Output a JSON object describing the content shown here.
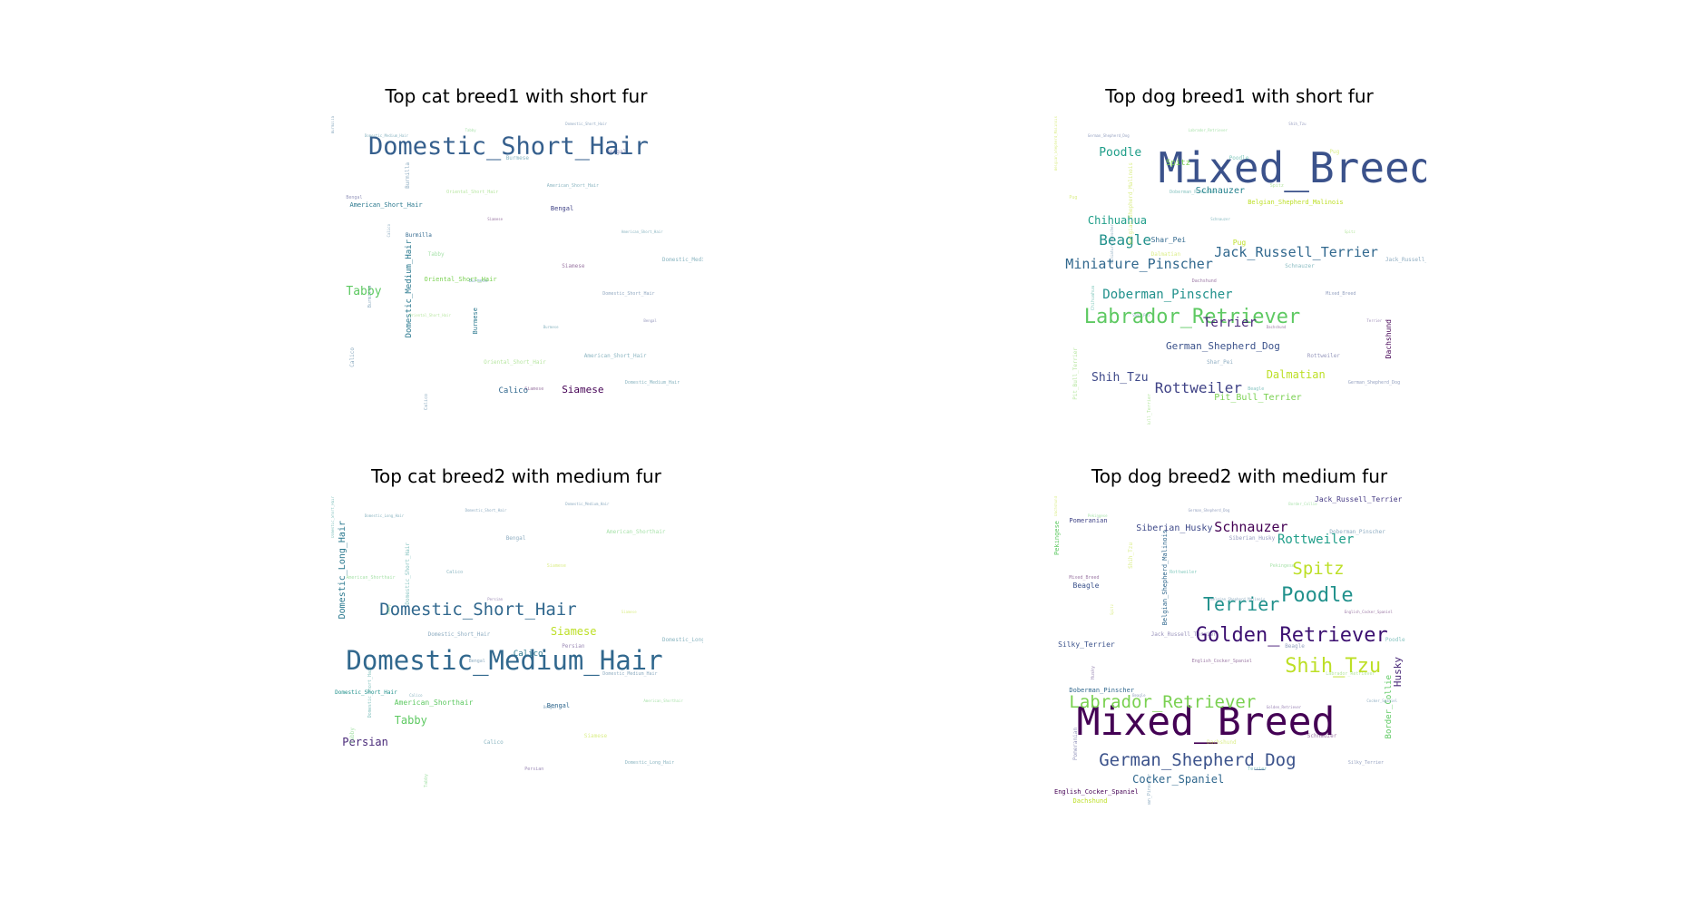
{
  "chart_data": [
    {
      "type": "wordcloud",
      "title": "Top cat breed1 with short fur",
      "words": [
        {
          "text": "Domestic_Short_Hair",
          "weight": 100,
          "color": "#355f8d"
        },
        {
          "text": "Tabby",
          "weight": 30,
          "color": "#5ec962"
        },
        {
          "text": "Domestic_Medium_Hair",
          "weight": 17,
          "color": "#2a788e",
          "vertical": true
        },
        {
          "text": "Siamese",
          "weight": 23,
          "color": "#440154"
        },
        {
          "text": "Calico",
          "weight": 18,
          "color": "#31688e"
        },
        {
          "text": "American_Short_Hair",
          "weight": 13,
          "color": "#2a788e"
        },
        {
          "text": "Oriental_Short_Hair",
          "weight": 12,
          "color": "#7ad151"
        },
        {
          "text": "Bengal",
          "weight": 12,
          "color": "#414487"
        },
        {
          "text": "Burmese",
          "weight": 10,
          "color": "#2a788e",
          "vertical": true
        },
        {
          "text": "Burmilla",
          "weight": 10,
          "color": "#31688e"
        }
      ]
    },
    {
      "type": "wordcloud",
      "title": "Top dog breed1 with short fur",
      "words": [
        {
          "text": "Mixed_Breed",
          "weight": 100,
          "color": "#3b528b"
        },
        {
          "text": "Labrador_Retriever",
          "weight": 52,
          "color": "#5ec962"
        },
        {
          "text": "Jack_Russell_Terrier",
          "weight": 36,
          "color": "#31688e"
        },
        {
          "text": "Beagle",
          "weight": 38,
          "color": "#21918c"
        },
        {
          "text": "Miniature_Pinscher",
          "weight": 35,
          "color": "#31688e"
        },
        {
          "text": "Rottweiler",
          "weight": 37,
          "color": "#414487"
        },
        {
          "text": "Doberman_Pinscher",
          "weight": 31,
          "color": "#21918c"
        },
        {
          "text": "Terrier",
          "weight": 31,
          "color": "#482878"
        },
        {
          "text": "Poodle",
          "weight": 30,
          "color": "#1f9e89"
        },
        {
          "text": "Chihuahua",
          "weight": 28,
          "color": "#1f9e89"
        },
        {
          "text": "Shih_Tzu",
          "weight": 30,
          "color": "#3e4989"
        },
        {
          "text": "Dalmatian",
          "weight": 28,
          "color": "#bddf26"
        },
        {
          "text": "German_Shepherd_Dog",
          "weight": 25,
          "color": "#3b528b"
        },
        {
          "text": "Schnauzer",
          "weight": 22,
          "color": "#26828e"
        },
        {
          "text": "Pit_Bull_Terrier",
          "weight": 21,
          "color": "#7ad151"
        },
        {
          "text": "Spitz",
          "weight": 20,
          "color": "#7ad151"
        },
        {
          "text": "Shar_Pei",
          "weight": 17,
          "color": "#31688e"
        },
        {
          "text": "Pug",
          "weight": 17,
          "color": "#bddf26"
        },
        {
          "text": "Dachshund",
          "weight": 17,
          "color": "#440154",
          "vertical": true
        },
        {
          "text": "Belgian_Shepherd_Malinois",
          "weight": 15,
          "color": "#bddf26"
        }
      ]
    },
    {
      "type": "wordcloud",
      "title": "Top cat breed2 with medium fur",
      "words": [
        {
          "text": "Domestic_Medium_Hair",
          "weight": 100,
          "color": "#31688e"
        },
        {
          "text": "Domestic_Short_Hair",
          "weight": 65,
          "color": "#31688e"
        },
        {
          "text": "Domestic_Long_Hair",
          "weight": 35,
          "color": "#2a788e",
          "vertical": true
        },
        {
          "text": "Persian",
          "weight": 34,
          "color": "#482878"
        },
        {
          "text": "Tabby",
          "weight": 34,
          "color": "#5ec962"
        },
        {
          "text": "Siamese",
          "weight": 30,
          "color": "#bddf26"
        },
        {
          "text": "Calico",
          "weight": 24,
          "color": "#2a788e"
        },
        {
          "text": "American_Shorthair",
          "weight": 18,
          "color": "#5ec962"
        },
        {
          "text": "Bengal",
          "weight": 16,
          "color": "#31688e"
        },
        {
          "text": "Domestic_Short_Hair",
          "weight": 14,
          "color": "#21918c"
        }
      ]
    },
    {
      "type": "wordcloud",
      "title": "Top dog breed2 with medium fur",
      "words": [
        {
          "text": "Mixed_Breed",
          "weight": 100,
          "color": "#440154"
        },
        {
          "text": "Golden_Retriever",
          "weight": 53,
          "color": "#3b0f70"
        },
        {
          "text": "Shih_Tzu",
          "weight": 55,
          "color": "#bddf26"
        },
        {
          "text": "Labrador_Retriever",
          "weight": 44,
          "color": "#7ad151"
        },
        {
          "text": "German_Shepherd_Dog",
          "weight": 44,
          "color": "#3b528b"
        },
        {
          "text": "Poodle",
          "weight": 50,
          "color": "#21918c"
        },
        {
          "text": "Terrier",
          "weight": 48,
          "color": "#21918c"
        },
        {
          "text": "Spitz",
          "weight": 44,
          "color": "#bddf26"
        },
        {
          "text": "Schnauzer",
          "weight": 36,
          "color": "#440154"
        },
        {
          "text": "Rottweiler",
          "weight": 30,
          "color": "#1f9e89"
        },
        {
          "text": "Cocker_Spaniel",
          "weight": 27,
          "color": "#31688e"
        },
        {
          "text": "Siberian_Husky",
          "weight": 23,
          "color": "#3e4989"
        },
        {
          "text": "Husky",
          "weight": 23,
          "color": "#482878",
          "vertical": true
        },
        {
          "text": "Border_Collie",
          "weight": 20,
          "color": "#5ec962",
          "vertical": true
        },
        {
          "text": "Jack_Russell_Terrier",
          "weight": 20,
          "color": "#443983"
        },
        {
          "text": "Silky_Terrier",
          "weight": 19,
          "color": "#3b528b"
        },
        {
          "text": "Belgian_Shepherd_Malinois",
          "weight": 18,
          "color": "#31688e",
          "vertical": true
        },
        {
          "text": "Pomeranian",
          "weight": 18,
          "color": "#414487"
        },
        {
          "text": "Pekingese",
          "weight": 18,
          "color": "#5ec962",
          "vertical": true
        },
        {
          "text": "Beagle",
          "weight": 17,
          "color": "#3b528b"
        },
        {
          "text": "Doberman_Pinscher",
          "weight": 16,
          "color": "#31688e"
        },
        {
          "text": "English_Cocker_Spaniel",
          "weight": 15,
          "color": "#440154"
        },
        {
          "text": "Dachshund",
          "weight": 15,
          "color": "#bddf26"
        }
      ]
    }
  ]
}
